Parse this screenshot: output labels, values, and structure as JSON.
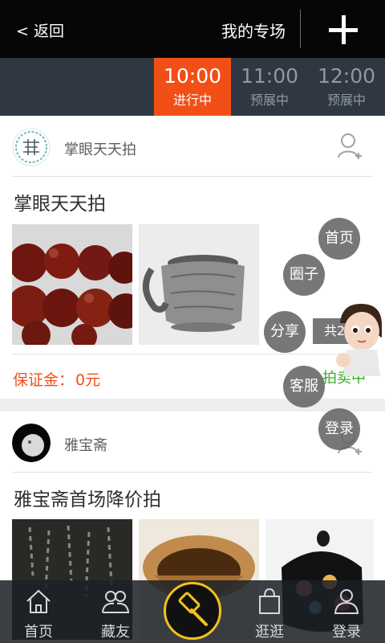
{
  "header": {
    "back_label": "< 返回",
    "my_special_label": "我的专场"
  },
  "timeslots": [
    {
      "time": "10:00",
      "status": "进行中",
      "active": true
    },
    {
      "time": "11:00",
      "status": "预展中",
      "active": false
    },
    {
      "time": "12:00",
      "status": "预展中",
      "active": false
    }
  ],
  "cards": [
    {
      "seller": "掌眼天天拍",
      "title": "掌眼天天拍",
      "deposit_label": "保证金：",
      "deposit_value": "0元"
    },
    {
      "seller": "雅宝斋",
      "title": "雅宝斋首场降价拍"
    }
  ],
  "floating_menu": {
    "home": "首页",
    "circle": "圈子",
    "share": "分享",
    "service": "客服",
    "login": "登录",
    "total": "共2",
    "selling": "拍卖中"
  },
  "bottom_nav": [
    {
      "label": "首页",
      "icon": "home-icon"
    },
    {
      "label": "藏友",
      "icon": "friends-icon"
    },
    {
      "label": "",
      "icon": "auction-hammer-icon"
    },
    {
      "label": "逛逛",
      "icon": "shopping-bag-icon"
    },
    {
      "label": "登录",
      "icon": "user-icon"
    }
  ],
  "colors": {
    "accent": "#f24f17",
    "topbar": "#060606",
    "timebar": "#2f3842",
    "hammer_ring": "#f1c21c",
    "selling_green": "#3cac2a"
  }
}
